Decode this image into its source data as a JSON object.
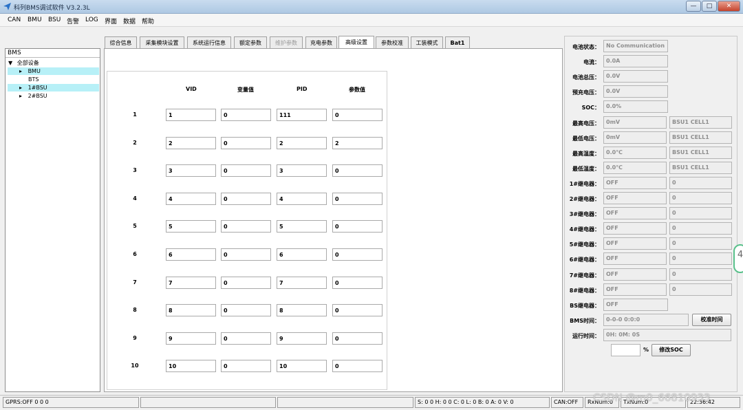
{
  "window": {
    "title": "科列BMS调试软件 V3.2.3L",
    "min": "—",
    "max": "□",
    "close": "✕"
  },
  "menu": [
    "CAN",
    "BMU",
    "BSU",
    "告警",
    "LOG",
    "界面",
    "数据",
    "帮助"
  ],
  "tree": {
    "header": "BMS",
    "root": "全部设备",
    "items": [
      "BMU",
      "BTS",
      "1#BSU",
      "2#BSU"
    ]
  },
  "tabs": [
    "综合信息",
    "采集模块设置",
    "系统运行信息",
    "额定参数",
    "维护参数",
    "充电参数",
    "高级设置",
    "参数校准",
    "工装模式",
    "Bat1"
  ],
  "table": {
    "headers": [
      "VID",
      "变量值",
      "PID",
      "参数值"
    ],
    "rows": [
      {
        "n": "1",
        "vid": "1",
        "var": "0",
        "pid": "111",
        "val": "0"
      },
      {
        "n": "2",
        "vid": "2",
        "var": "0",
        "pid": "2",
        "val": "2"
      },
      {
        "n": "3",
        "vid": "3",
        "var": "0",
        "pid": "3",
        "val": "0"
      },
      {
        "n": "4",
        "vid": "4",
        "var": "0",
        "pid": "4",
        "val": "0"
      },
      {
        "n": "5",
        "vid": "5",
        "var": "0",
        "pid": "5",
        "val": "0"
      },
      {
        "n": "6",
        "vid": "6",
        "var": "0",
        "pid": "6",
        "val": "0"
      },
      {
        "n": "7",
        "vid": "7",
        "var": "0",
        "pid": "7",
        "val": "0"
      },
      {
        "n": "8",
        "vid": "8",
        "var": "0",
        "pid": "8",
        "val": "0"
      },
      {
        "n": "9",
        "vid": "9",
        "var": "0",
        "pid": "9",
        "val": "0"
      },
      {
        "n": "10",
        "vid": "10",
        "var": "0",
        "pid": "10",
        "val": "0"
      }
    ]
  },
  "status_panel": {
    "rows": [
      {
        "label": "电池状态：",
        "value": "No Communication",
        "extra": ""
      },
      {
        "label": "电流：",
        "value": "0.0A",
        "extra": ""
      },
      {
        "label": "电池总压：",
        "value": "0.0V",
        "extra": ""
      },
      {
        "label": "预充电压：",
        "value": "0.0V",
        "extra": ""
      },
      {
        "label": "SOC：",
        "value": "0.0%",
        "extra": ""
      },
      {
        "label": "最高电压：",
        "value": "0mV",
        "extra": "BSU1 CELL1"
      },
      {
        "label": "最低电压：",
        "value": "0mV",
        "extra": "BSU1 CELL1"
      },
      {
        "label": "最高温度：",
        "value": "0.0℃",
        "extra": "BSU1 CELL1"
      },
      {
        "label": "最低温度：",
        "value": "0.0℃",
        "extra": "BSU1 CELL1"
      },
      {
        "label": "1#继电器：",
        "value": "OFF",
        "extra": "0"
      },
      {
        "label": "2#继电器：",
        "value": "OFF",
        "extra": "0"
      },
      {
        "label": "3#继电器：",
        "value": "OFF",
        "extra": "0"
      },
      {
        "label": "4#继电器：",
        "value": "OFF",
        "extra": "0"
      },
      {
        "label": "5#继电器：",
        "value": "OFF",
        "extra": "0"
      },
      {
        "label": "6#继电器：",
        "value": "OFF",
        "extra": "0"
      },
      {
        "label": "7#继电器：",
        "value": "OFF",
        "extra": "0"
      },
      {
        "label": "8#继电器：",
        "value": "OFF",
        "extra": "0"
      },
      {
        "label": "BS继电器：",
        "value": "OFF",
        "extra": ""
      }
    ],
    "bms_time_label": "BMS时间：",
    "bms_time": "0-0-0 0:0:0",
    "calibrate_time_button": "校准时间",
    "run_time_label": "运行时间：",
    "run_time": "0H: 0M: 0S",
    "soc_input": "",
    "percent": "%",
    "modify_soc_button": "修改SOC"
  },
  "statusbar": {
    "gprs": "GPRS:OFF  0  0  0",
    "s": "S:  0  0 H:  0  0 C:  0 L:  0 B:  0 A:  0  V:  0",
    "can": "CAN:OFF",
    "rx": "RxNum:0",
    "tx": "TxNum:0",
    "time": "22:36:42"
  },
  "watermark": "CSDN @m0_66810933",
  "edge_badge": "4"
}
